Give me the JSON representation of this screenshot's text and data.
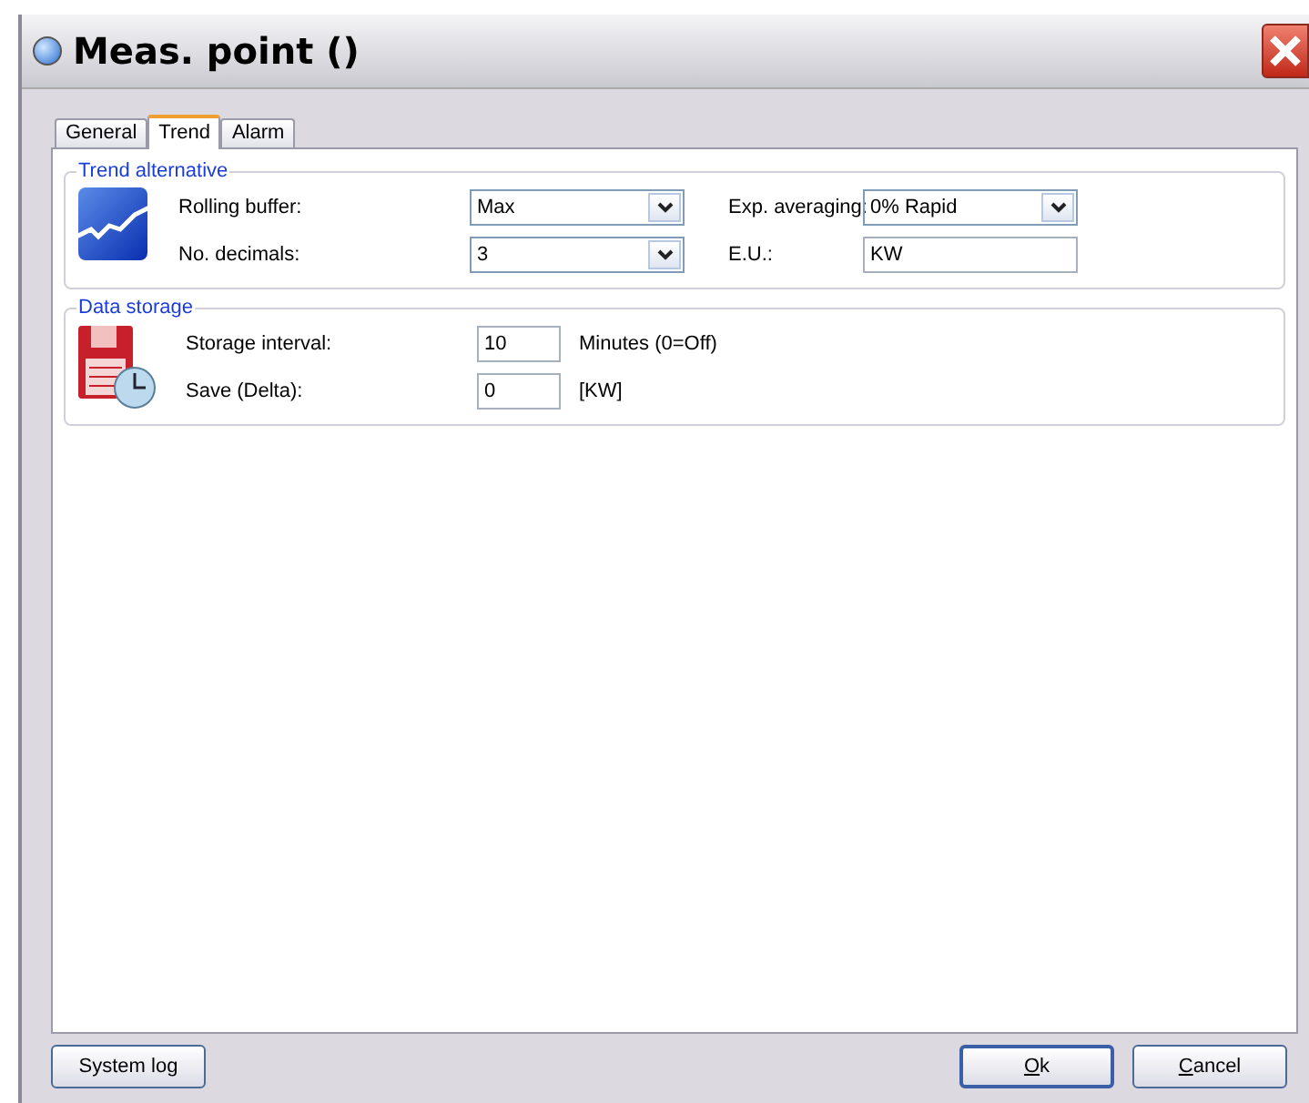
{
  "window": {
    "title": "Meas. point ()"
  },
  "tabs": [
    {
      "label": "General",
      "selected": false
    },
    {
      "label": "Trend",
      "selected": true
    },
    {
      "label": "Alarm",
      "selected": false
    }
  ],
  "trend_alternative": {
    "title": "Trend alternative",
    "fields": [
      {
        "kind": "dropdown",
        "label": "Rolling buffer:",
        "value": "Max"
      },
      {
        "kind": "dropdown",
        "label": "Exp. averaging:",
        "value": "0% Rapid"
      },
      {
        "kind": "dropdown",
        "label": "No. decimals:",
        "value": "3"
      },
      {
        "kind": "text",
        "label": "E.U.:",
        "value": "KW"
      }
    ]
  },
  "data_storage": {
    "title": "Data storage",
    "fields": [
      {
        "label": "Storage interval:",
        "value": "10",
        "unit": "Minutes (0=Off)"
      },
      {
        "label": "Save (Delta):",
        "value": "0",
        "unit": "[KW]"
      }
    ]
  },
  "buttons": {
    "left": [
      {
        "label": "System log",
        "underline_first": false
      }
    ],
    "right": [
      {
        "label": "Ok",
        "underline_first": true
      },
      {
        "label": "Cancel",
        "underline_first": true
      }
    ]
  }
}
